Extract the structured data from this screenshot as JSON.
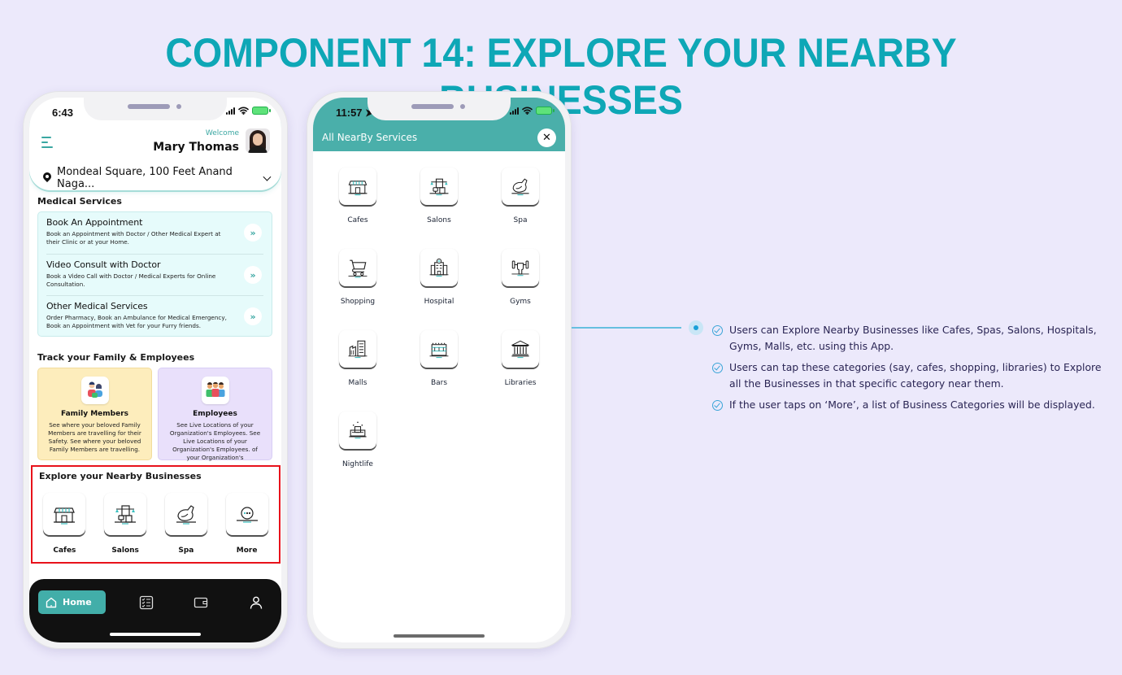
{
  "page": {
    "title": "COMPONENT 14: EXPLORE YOUR NEARBY BUSINESSES"
  },
  "colors": {
    "title": "#0ea7b6",
    "teal_primary": "#4aafaa",
    "highlight_border": "#e8121b",
    "background": "#ece9fb"
  },
  "phone1": {
    "status_time": "6:43",
    "header": {
      "menu_icon": "hamburger-icon",
      "welcome": "Welcome",
      "user_name": "Mary Thomas",
      "location": "Mondeal Square, 100 Feet Anand Naga..."
    },
    "medical": {
      "title": "Medical Services",
      "items": [
        {
          "title": "Book An Appointment",
          "desc": "Book an Appointment with Doctor / Other Medical Expert at their Clinic or at your Home."
        },
        {
          "title": "Video Consult with Doctor",
          "desc": "Book a Video Call with Doctor / Medical Experts for Online Consultation."
        },
        {
          "title": "Other Medical Services",
          "desc": "Order Pharmacy, Book an Ambulance for Medical Emergency, Book an Appointment with Vet for your Furry friends."
        }
      ]
    },
    "track": {
      "title": "Track your Family & Employees",
      "family": {
        "title": "Family Members",
        "desc": "See where your beloved Family Members are travelling for their Safety. See where your beloved Family Members are travelling."
      },
      "employees": {
        "title": "Employees",
        "desc": "See Live Locations of your Organization's Employees. See Live Locations of your Organization's Employees. of your Organization's"
      }
    },
    "explore": {
      "title": "Explore your Nearby Businesses",
      "categories": [
        {
          "label": "Cafes",
          "icon": "cafe-icon"
        },
        {
          "label": "Salons",
          "icon": "salon-icon"
        },
        {
          "label": "Spa",
          "icon": "spa-icon"
        },
        {
          "label": "More",
          "icon": "more-icon"
        }
      ]
    },
    "nav": {
      "home_label": "Home",
      "items": [
        "home-icon",
        "checklist-icon",
        "wallet-icon",
        "profile-icon"
      ]
    }
  },
  "phone2": {
    "status_time": "11:57",
    "title": "All NearBy Services",
    "close_icon": "close-icon",
    "categories": [
      {
        "label": "Cafes",
        "icon": "cafe-icon"
      },
      {
        "label": "Salons",
        "icon": "salon-icon"
      },
      {
        "label": "Spa",
        "icon": "spa-icon"
      },
      {
        "label": "Shopping",
        "icon": "cart-icon"
      },
      {
        "label": "Hospital",
        "icon": "hospital-icon"
      },
      {
        "label": "Gyms",
        "icon": "dumbbell-icon"
      },
      {
        "label": "Malls",
        "icon": "mall-icon"
      },
      {
        "label": "Bars",
        "icon": "bar-icon"
      },
      {
        "label": "Libraries",
        "icon": "library-icon"
      },
      {
        "label": "Nightlife",
        "icon": "nightlife-icon"
      }
    ]
  },
  "bullets": [
    "Users can Explore Nearby Businesses like Cafes, Spas, Salons, Hospitals, Gyms, Malls, etc. using this App.",
    "Users can tap these categories (say, cafes, shopping, libraries) to Explore all the Businesses in that specific category near them.",
    "If the user taps on ‘More’, a list of Business Categories will be displayed."
  ]
}
